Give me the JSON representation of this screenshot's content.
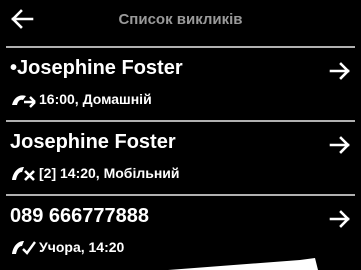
{
  "header": {
    "title": "Список викликів"
  },
  "entries": [
    {
      "unread_marker": "•",
      "name": "Josephine Foster",
      "detail": "16:00, Домашній",
      "call_icon": "outgoing-call-icon"
    },
    {
      "unread_marker": "",
      "name": "Josephine Foster",
      "detail": "[2] 14:20, Мобільний",
      "call_icon": "missed-call-icon"
    },
    {
      "unread_marker": "",
      "name": "089 666777888",
      "detail": "Учора, 14:20",
      "call_icon": "answered-call-icon"
    }
  ],
  "colors": {
    "background": "#000000",
    "text": "#ffffff",
    "title": "#9a9a9a",
    "divider": "#b0b0b0"
  }
}
